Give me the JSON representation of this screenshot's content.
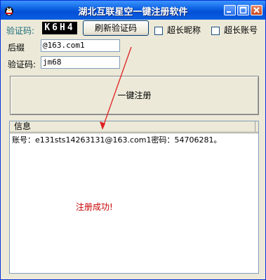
{
  "window": {
    "title": "湖北互联星空一键注册软件",
    "controls": {
      "minimize": "minimize",
      "maximize": "maximize",
      "close": "close"
    }
  },
  "row1": {
    "captcha_label": "验证码:",
    "captcha_text": "K6H4",
    "refresh_button": "刷新验证码",
    "checkbox_long_nickname": "超长昵称",
    "checkbox_long_account": "超长账号"
  },
  "suffix": {
    "label": "后缀",
    "value": "@163.com1"
  },
  "verify": {
    "label": "验证码:",
    "value": "jm68"
  },
  "register_button": "一键注册",
  "log": {
    "column_header": "信息",
    "rows": [
      "账号：e131sts14263131@163.com1密码：54706281。"
    ]
  },
  "status": {
    "text": "注册成功!"
  },
  "colors": {
    "title_bar": "#0a5fe0",
    "status_text": "#c80000",
    "label_teal": "#1a6b78",
    "arrow": "#e02020"
  }
}
